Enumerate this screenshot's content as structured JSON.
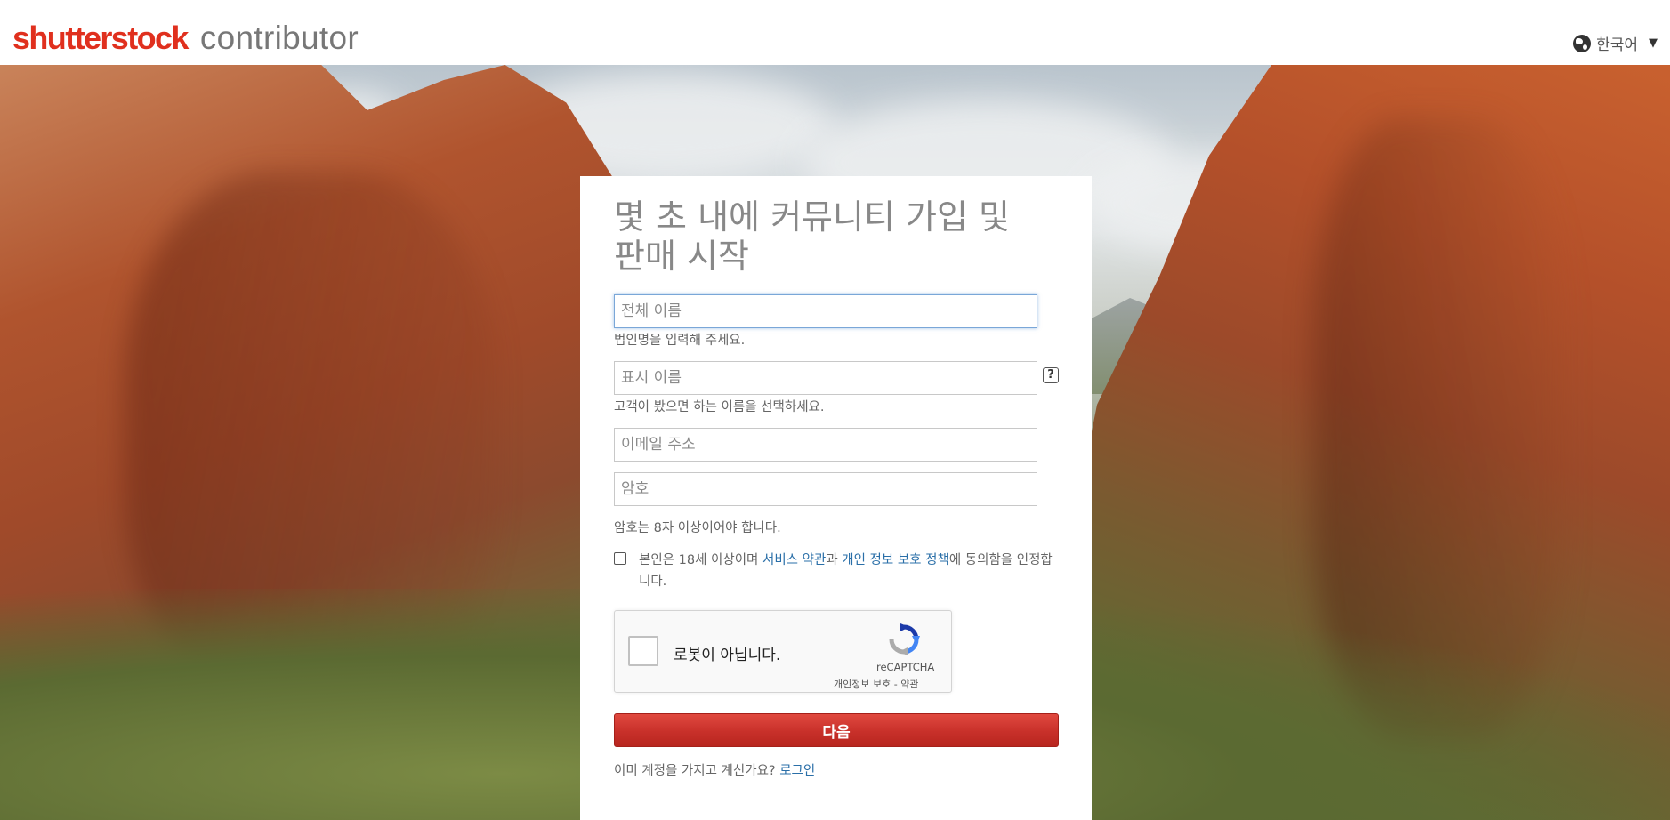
{
  "header": {
    "logo_main": "shutterstock",
    "logo_sub": "contributor",
    "language_label": "한국어"
  },
  "form": {
    "title": "몇 초 내에 커뮤니티 가입 및 판매 시작",
    "full_name_placeholder": "전체 이름",
    "full_name_hint": "법인명을 입력해 주세요.",
    "display_name_placeholder": "표시 이름",
    "display_name_help": "?",
    "display_name_hint": "고객이 봤으면 하는 이름을 선택하세요.",
    "email_placeholder": "이메일 주소",
    "password_placeholder": "암호",
    "password_hint": "암호는 8자 이상이어야 합니다.",
    "agree_prefix": "본인은 18세 이상이며 ",
    "terms_link": "서비스 약관",
    "agree_mid": "과 ",
    "privacy_link": "개인 정보 보호 정책",
    "agree_suffix": "에 동의함을 인정합니다.",
    "recaptcha_label": "로봇이 아닙니다.",
    "recaptcha_brand": "reCAPTCHA",
    "recaptcha_privacy": "개인정보 보호",
    "recaptcha_sep": " - ",
    "recaptcha_terms": "약관",
    "next_button": "다음",
    "login_prompt": "이미 계정을 가지고 계신가요? ",
    "login_link": "로그인"
  },
  "colors": {
    "brand_red": "#e0301e",
    "link_blue": "#2a6fa8",
    "button_red": "#c8302a"
  },
  "icons": {
    "language": "globe-icon",
    "dropdown": "caret-down-icon",
    "recaptcha": "recaptcha-logo-icon"
  }
}
